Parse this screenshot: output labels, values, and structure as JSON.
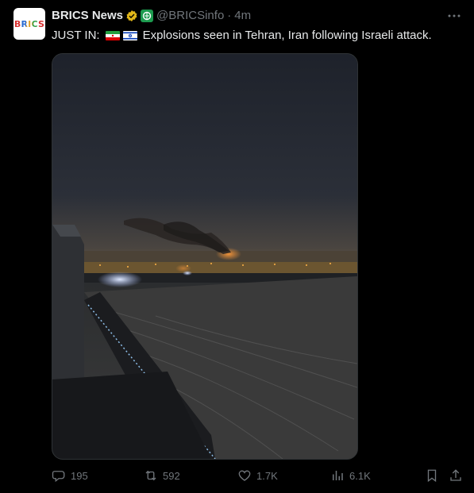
{
  "tweet": {
    "avatar_text": "BRICS",
    "name": "BRICS News",
    "handle": "@BRICSinfo",
    "separator": "·",
    "time": "4m",
    "text_prefix": "JUST IN:",
    "text_body": "Explosions seen in Tehran, Iran following Israeli attack."
  },
  "actions": {
    "replies": "195",
    "reposts": "592",
    "likes": "1.7K",
    "views": "6.1K"
  },
  "icons": [
    "more-icon",
    "verified-icon",
    "affiliate-icon",
    "iran-flag-icon",
    "israel-flag-icon",
    "reply-icon",
    "repost-icon",
    "like-icon",
    "views-icon",
    "bookmark-icon",
    "share-icon"
  ],
  "colors": {
    "background": "#000000",
    "text": "#e7e9ea",
    "muted": "#71767b",
    "verified": "#e2b719"
  }
}
